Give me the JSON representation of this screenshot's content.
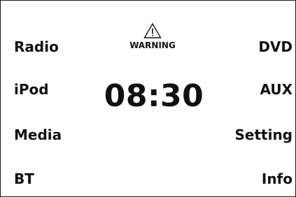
{
  "warning": {
    "icon": "warning-triangle-icon",
    "label": "WARNING"
  },
  "clock": {
    "time": "08:30"
  },
  "menu": {
    "left": [
      {
        "label": "Radio"
      },
      {
        "label": "iPod"
      },
      {
        "label": "Media"
      },
      {
        "label": "BT"
      }
    ],
    "right": [
      {
        "label": "DVD"
      },
      {
        "label": "AUX"
      },
      {
        "label": "Setting"
      },
      {
        "label": "Info"
      }
    ]
  }
}
